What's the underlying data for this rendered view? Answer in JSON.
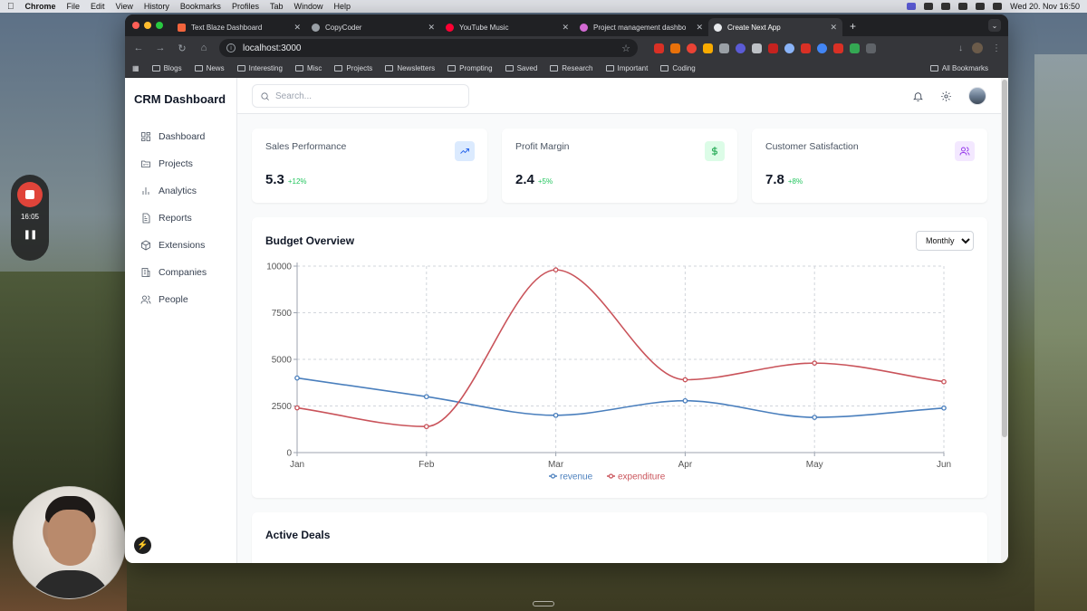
{
  "menubar": {
    "app": "Chrome",
    "items": [
      "File",
      "Edit",
      "View",
      "History",
      "Bookmarks",
      "Profiles",
      "Tab",
      "Window",
      "Help"
    ],
    "clock": "Wed 20. Nov 16:50"
  },
  "recorder": {
    "time": "16:05"
  },
  "browser": {
    "tabs": [
      {
        "title": "Text Blaze Dashboard",
        "color": "#f2643c"
      },
      {
        "title": "CopyCoder",
        "color": "#9aa0a6"
      },
      {
        "title": "YouTube Music",
        "color": "#ff0033"
      },
      {
        "title": "Project management dashbo",
        "color": "#d36ad3"
      },
      {
        "title": "Create Next App",
        "color": "#e8eaed"
      }
    ],
    "url": "localhost:3000",
    "bookmarks": [
      "Blogs",
      "News",
      "Interesting",
      "Misc",
      "Projects",
      "Newsletters",
      "Prompting",
      "Saved",
      "Research",
      "Important",
      "Coding"
    ],
    "all_bookmarks": "All Bookmarks"
  },
  "app": {
    "brand": "CRM Dashboard",
    "nav": [
      "Dashboard",
      "Projects",
      "Analytics",
      "Reports",
      "Extensions",
      "Companies",
      "People"
    ],
    "search_placeholder": "Search...",
    "cards": [
      {
        "title": "Sales Performance",
        "value": "5.3",
        "delta": "+12%",
        "icon": "trending-up-icon",
        "icon_bg": "#dbeafe",
        "icon_color": "#2563eb"
      },
      {
        "title": "Profit Margin",
        "value": "2.4",
        "delta": "+5%",
        "icon": "dollar-icon",
        "icon_bg": "#dcfce7",
        "icon_color": "#16a34a"
      },
      {
        "title": "Customer Satisfaction",
        "value": "7.8",
        "delta": "+8%",
        "icon": "users-icon",
        "icon_bg": "#f3e8ff",
        "icon_color": "#9333ea"
      }
    ],
    "budget": {
      "title": "Budget Overview",
      "period_options": [
        "Monthly"
      ],
      "period_selected": "Monthly"
    },
    "deals_title": "Active Deals"
  },
  "chart_data": {
    "type": "line",
    "categories": [
      "Jan",
      "Feb",
      "Mar",
      "Apr",
      "May",
      "Jun"
    ],
    "series": [
      {
        "name": "revenue",
        "color": "#4a7fbd",
        "values": [
          4000,
          3000,
          2000,
          2780,
          1890,
          2390
        ]
      },
      {
        "name": "expenditure",
        "color": "#c9535a",
        "values": [
          2400,
          1398,
          9800,
          3908,
          4800,
          3800
        ]
      }
    ],
    "yticks": [
      0,
      2500,
      5000,
      7500,
      10000
    ],
    "ylim": [
      0,
      10000
    ],
    "grid": true,
    "legend": "bottom-center"
  }
}
